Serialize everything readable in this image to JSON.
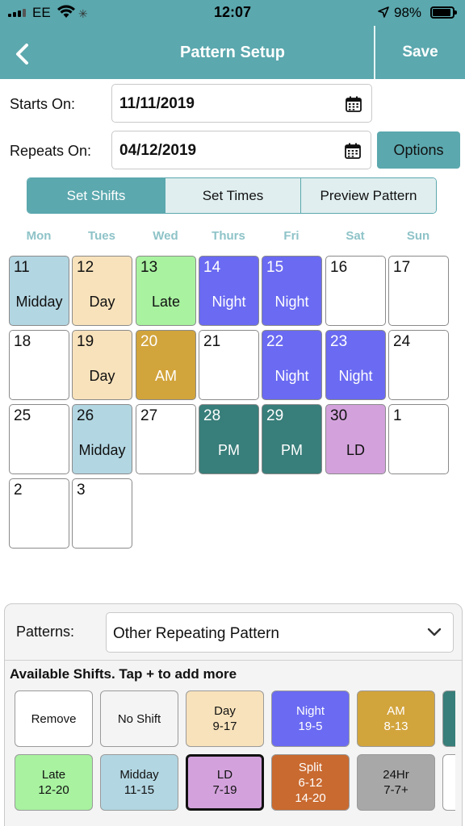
{
  "status": {
    "carrier": "EE",
    "time": "12:07",
    "battery": "98%"
  },
  "nav": {
    "title": "Pattern Setup",
    "save_label": "Save"
  },
  "form": {
    "starts_label": "Starts On:",
    "starts_value": "11/11/2019",
    "repeats_label": "Repeats On:",
    "repeats_value": "04/12/2019",
    "options_label": "Options"
  },
  "tabs": [
    "Set Shifts",
    "Set Times",
    "Preview Pattern"
  ],
  "weekdays": [
    "Mon",
    "Tues",
    "Wed",
    "Thurs",
    "Fri",
    "Sat",
    "Sun"
  ],
  "calendar": [
    {
      "day": "11",
      "shift": "Midday"
    },
    {
      "day": "12",
      "shift": "Day"
    },
    {
      "day": "13",
      "shift": "Late"
    },
    {
      "day": "14",
      "shift": "Night"
    },
    {
      "day": "15",
      "shift": "Night"
    },
    {
      "day": "16",
      "shift": ""
    },
    {
      "day": "17",
      "shift": ""
    },
    {
      "day": "18",
      "shift": ""
    },
    {
      "day": "19",
      "shift": "Day"
    },
    {
      "day": "20",
      "shift": "AM"
    },
    {
      "day": "21",
      "shift": ""
    },
    {
      "day": "22",
      "shift": "Night"
    },
    {
      "day": "23",
      "shift": "Night"
    },
    {
      "day": "24",
      "shift": ""
    },
    {
      "day": "25",
      "shift": ""
    },
    {
      "day": "26",
      "shift": "Midday"
    },
    {
      "day": "27",
      "shift": ""
    },
    {
      "day": "28",
      "shift": "PM"
    },
    {
      "day": "29",
      "shift": "PM"
    },
    {
      "day": "30",
      "shift": "LD"
    },
    {
      "day": "1",
      "shift": ""
    },
    {
      "day": "2",
      "shift": ""
    },
    {
      "day": "3",
      "shift": ""
    }
  ],
  "shift_colors": {
    "Midday": "#b2d6e2",
    "Day": "#f8e2bb",
    "Late": "#a8f2a0",
    "Night": "#6a6af2",
    "AM": "#d2a43c",
    "PM": "#387e7a",
    "LD": "#d3a2dc",
    "None": "#ffffff",
    "Split": "#c96a30",
    "24Hr": "#a8a8a8",
    "NoShift": "#f4f4f4"
  },
  "panel": {
    "patterns_label": "Patterns:",
    "pattern_value": "Other Repeating Pattern",
    "available_title": "Available Shifts. Tap + to add more"
  },
  "shift_tiles": [
    {
      "name": "Remove",
      "time": "",
      "color": "#ffffff",
      "light": false
    },
    {
      "name": "No Shift",
      "time": "",
      "color": "#f4f4f4",
      "light": false
    },
    {
      "name": "Day",
      "time": "9-17",
      "color": "#f8e2bb",
      "light": false
    },
    {
      "name": "Night",
      "time": "19-5",
      "color": "#6a6af2",
      "light": true
    },
    {
      "name": "AM",
      "time": "8-13",
      "color": "#d2a43c",
      "light": true
    },
    {
      "name": "Late",
      "time": "12-20",
      "color": "#a8f2a0",
      "light": false
    },
    {
      "name": "Midday",
      "time": "11-15",
      "color": "#b2d6e2",
      "light": false
    },
    {
      "name": "LD",
      "time": "7-19",
      "color": "#d3a2dc",
      "light": false,
      "selected": true
    },
    {
      "name": "Split",
      "time": "6-12\n14-20",
      "color": "#c96a30",
      "light": true
    },
    {
      "name": "24Hr",
      "time": "7-7+",
      "color": "#a8a8a8",
      "light": false
    }
  ]
}
